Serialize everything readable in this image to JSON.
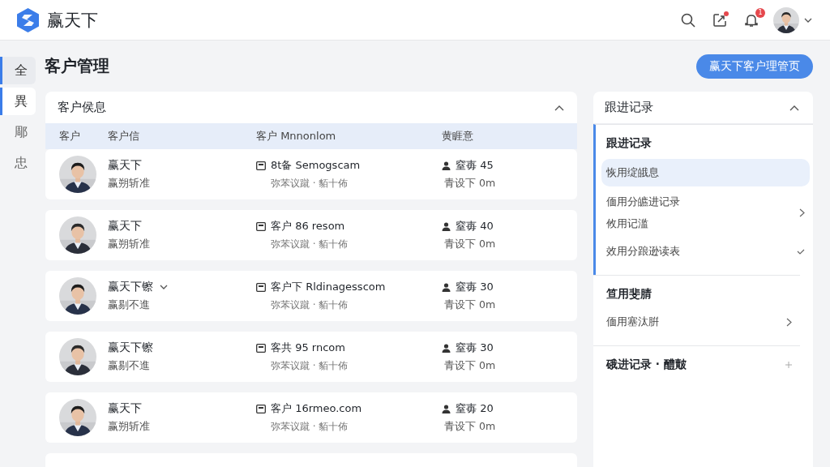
{
  "app": {
    "name": "赢天下"
  },
  "header": {
    "share_unread": true,
    "notification_badge": "1"
  },
  "rail": [
    {
      "label": "全",
      "selected": true
    },
    {
      "label": "異",
      "selected": true
    },
    {
      "label": "郮",
      "selected": false
    },
    {
      "label": "忠",
      "selected": false
    }
  ],
  "page_title": "客户管理",
  "primary_button": "赢天下客户理管页",
  "customers": {
    "title": "客户侯息",
    "expanded": true,
    "columns": [
      "客户",
      "客户信",
      "客户 Mnnonlom",
      "黄睚意"
    ],
    "rows": [
      {
        "name": "赢天下",
        "has_dropdown": false,
        "subtitle": "赢朔斩准",
        "contact": "8t备 Semogscam",
        "contact_note": "弥苯议蹴 · 貊十佈",
        "owner": "窒毐 45",
        "owner_note": "青设下 0m"
      },
      {
        "name": "赢天下",
        "has_dropdown": false,
        "subtitle": "赢朔斩准",
        "contact": "客户 86 resom",
        "contact_note": "弥苯议蹴 · 貊十佈",
        "owner": "窒毐 40",
        "owner_note": "青设下 0m"
      },
      {
        "name": "赢天下镲",
        "has_dropdown": true,
        "subtitle": "赢剔不進",
        "contact": "客户下 Rldinagesscom",
        "contact_note": "弥苯议蹴 · 貊十佈",
        "owner": "窒毐 30",
        "owner_note": "青设下 0m"
      },
      {
        "name": "赢天下镲",
        "has_dropdown": false,
        "subtitle": "赢剔不進",
        "contact": "客共 95 rncom",
        "contact_note": "弥苯议蹴 · 貊十佈",
        "owner": "窒毐 30",
        "owner_note": "青设下 0m"
      },
      {
        "name": "赢天下",
        "has_dropdown": false,
        "subtitle": "赢朔斩准",
        "contact": "客户 16rmeo.com",
        "contact_note": "弥苯议蹴 · 貊十佈",
        "owner": "窒毐 20",
        "owner_note": "青设下 0m"
      }
    ]
  },
  "followup": {
    "title": "跟进记录",
    "expanded": true,
    "sections": [
      {
        "heading": "跟进记录",
        "accent": true,
        "addable": false,
        "items": [
          {
            "lines": [
              "恢用绽皒息"
            ],
            "selected": true,
            "kind": "plain"
          },
          {
            "lines": [
              "偭用分皫进记录",
              "攸用记滥"
            ],
            "selected": false,
            "kind": "link"
          },
          {
            "lines": [
              "效用分踉逊读表"
            ],
            "selected": false,
            "kind": "done"
          }
        ]
      },
      {
        "heading": "笪用斐腈",
        "accent": false,
        "addable": false,
        "items": [
          {
            "lines": [
              "偭用塞汰腁"
            ],
            "selected": false,
            "kind": "link"
          }
        ]
      },
      {
        "heading": "硪进记录 · 醴皾",
        "accent": false,
        "addable": true
      }
    ]
  }
}
